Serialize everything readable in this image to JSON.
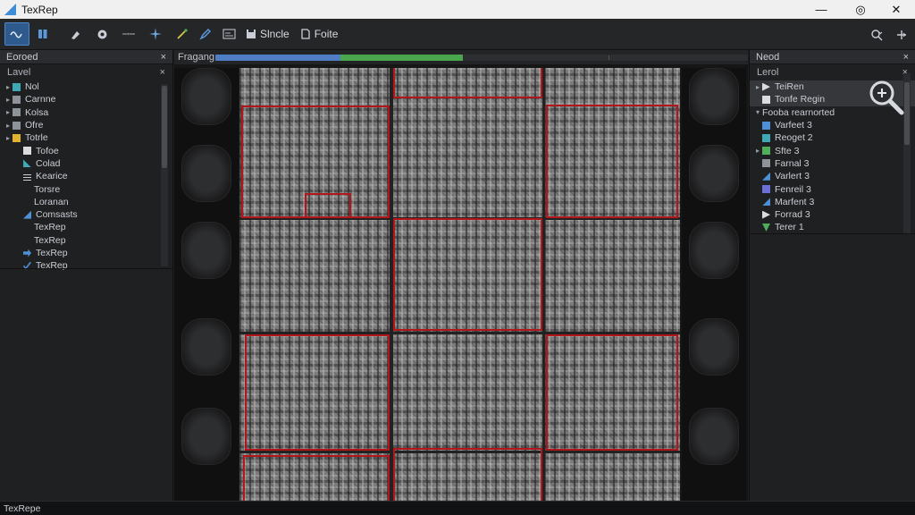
{
  "window": {
    "title": "TexRep",
    "minimize": "—",
    "maximize": "◎",
    "close": "✕"
  },
  "toolbar": {
    "buttons": [
      "pointer",
      "layers",
      "brush",
      "gear",
      "link",
      "sparkle",
      "wand",
      "pen",
      "image"
    ],
    "save_label": "Slncle",
    "open_label": "Foite",
    "search_icon": "search-icon",
    "add_icon": "plus-arrow-icon"
  },
  "left_panel": {
    "title": "Eoroed",
    "close": "×",
    "sub_title": "Lavel",
    "sub_close": "×",
    "items": [
      {
        "label": "Nol",
        "icon": "teal",
        "arrow": "▸",
        "level": 0
      },
      {
        "label": "Carnne",
        "icon": "grey",
        "arrow": "▸",
        "level": 0
      },
      {
        "label": "Kolsa",
        "icon": "grey",
        "arrow": "▸",
        "level": 0
      },
      {
        "label": "Ofre",
        "icon": "grey",
        "arrow": "▸",
        "level": 0
      },
      {
        "label": "Totrle",
        "icon": "yellow",
        "arrow": "▸",
        "level": 0
      },
      {
        "label": "Tofoe",
        "icon": "white",
        "arrow": "",
        "level": 1
      },
      {
        "label": "Colad",
        "icon": "teal-tri",
        "arrow": "",
        "level": 1
      },
      {
        "label": "Kearice",
        "icon": "lines",
        "arrow": "",
        "level": 1
      },
      {
        "label": "Torsre",
        "icon": "",
        "arrow": "",
        "level": 2
      },
      {
        "label": "Loranan",
        "icon": "",
        "arrow": "",
        "level": 2
      },
      {
        "label": "Comsasts",
        "icon": "blue-tri",
        "arrow": "",
        "level": 1
      },
      {
        "label": "TexRep",
        "icon": "",
        "arrow": "",
        "level": 2
      },
      {
        "label": "TexRep",
        "icon": "",
        "arrow": "",
        "level": 2
      },
      {
        "label": "TexRep",
        "icon": "blue-arrow",
        "arrow": "",
        "level": 1
      },
      {
        "label": "TexRep",
        "icon": "blue-check",
        "arrow": "",
        "level": 1
      }
    ]
  },
  "center": {
    "label": "Fragang",
    "progress_blue": 0.235,
    "progress_green": 0.229
  },
  "right_panel": {
    "title": "Neod",
    "close": "×",
    "sub_title": "Lerol",
    "sub_close": "×",
    "items": [
      {
        "label": "TeiRen",
        "icon": "white-arrow",
        "arrow": "▸",
        "sel": true
      },
      {
        "label": "Tonfe Regin",
        "icon": "white",
        "arrow": "",
        "sel": true
      },
      {
        "label": "Fooba rearnorted",
        "icon": "",
        "arrow": "▾",
        "sel": false
      },
      {
        "label": "Varfeet 3",
        "icon": "blue",
        "arrow": "",
        "sel": false
      },
      {
        "label": "Reoget 2",
        "icon": "teal",
        "arrow": "",
        "sel": false
      },
      {
        "label": "Sfte 3",
        "icon": "green",
        "arrow": "▸",
        "sel": false
      },
      {
        "label": "Farnal 3",
        "icon": "grey",
        "arrow": "",
        "sel": false
      },
      {
        "label": "Varlert 3",
        "icon": "blue-tri",
        "arrow": "",
        "sel": false
      },
      {
        "label": "Fenreil 3",
        "icon": "purple",
        "arrow": "",
        "sel": false
      },
      {
        "label": "Marfent 3",
        "icon": "blue-tri",
        "arrow": "",
        "sel": false
      },
      {
        "label": "Forrad 3",
        "icon": "white-arrow",
        "arrow": "",
        "sel": false
      },
      {
        "label": "Terer 1",
        "icon": "green-tri",
        "arrow": "",
        "sel": false
      }
    ]
  },
  "status": {
    "text": "TexRepe"
  },
  "colors": {
    "accent": "#2e5a8e",
    "mark": "#b3161a",
    "progress_blue": "#4f7ec4",
    "progress_green": "#4aa64e"
  }
}
